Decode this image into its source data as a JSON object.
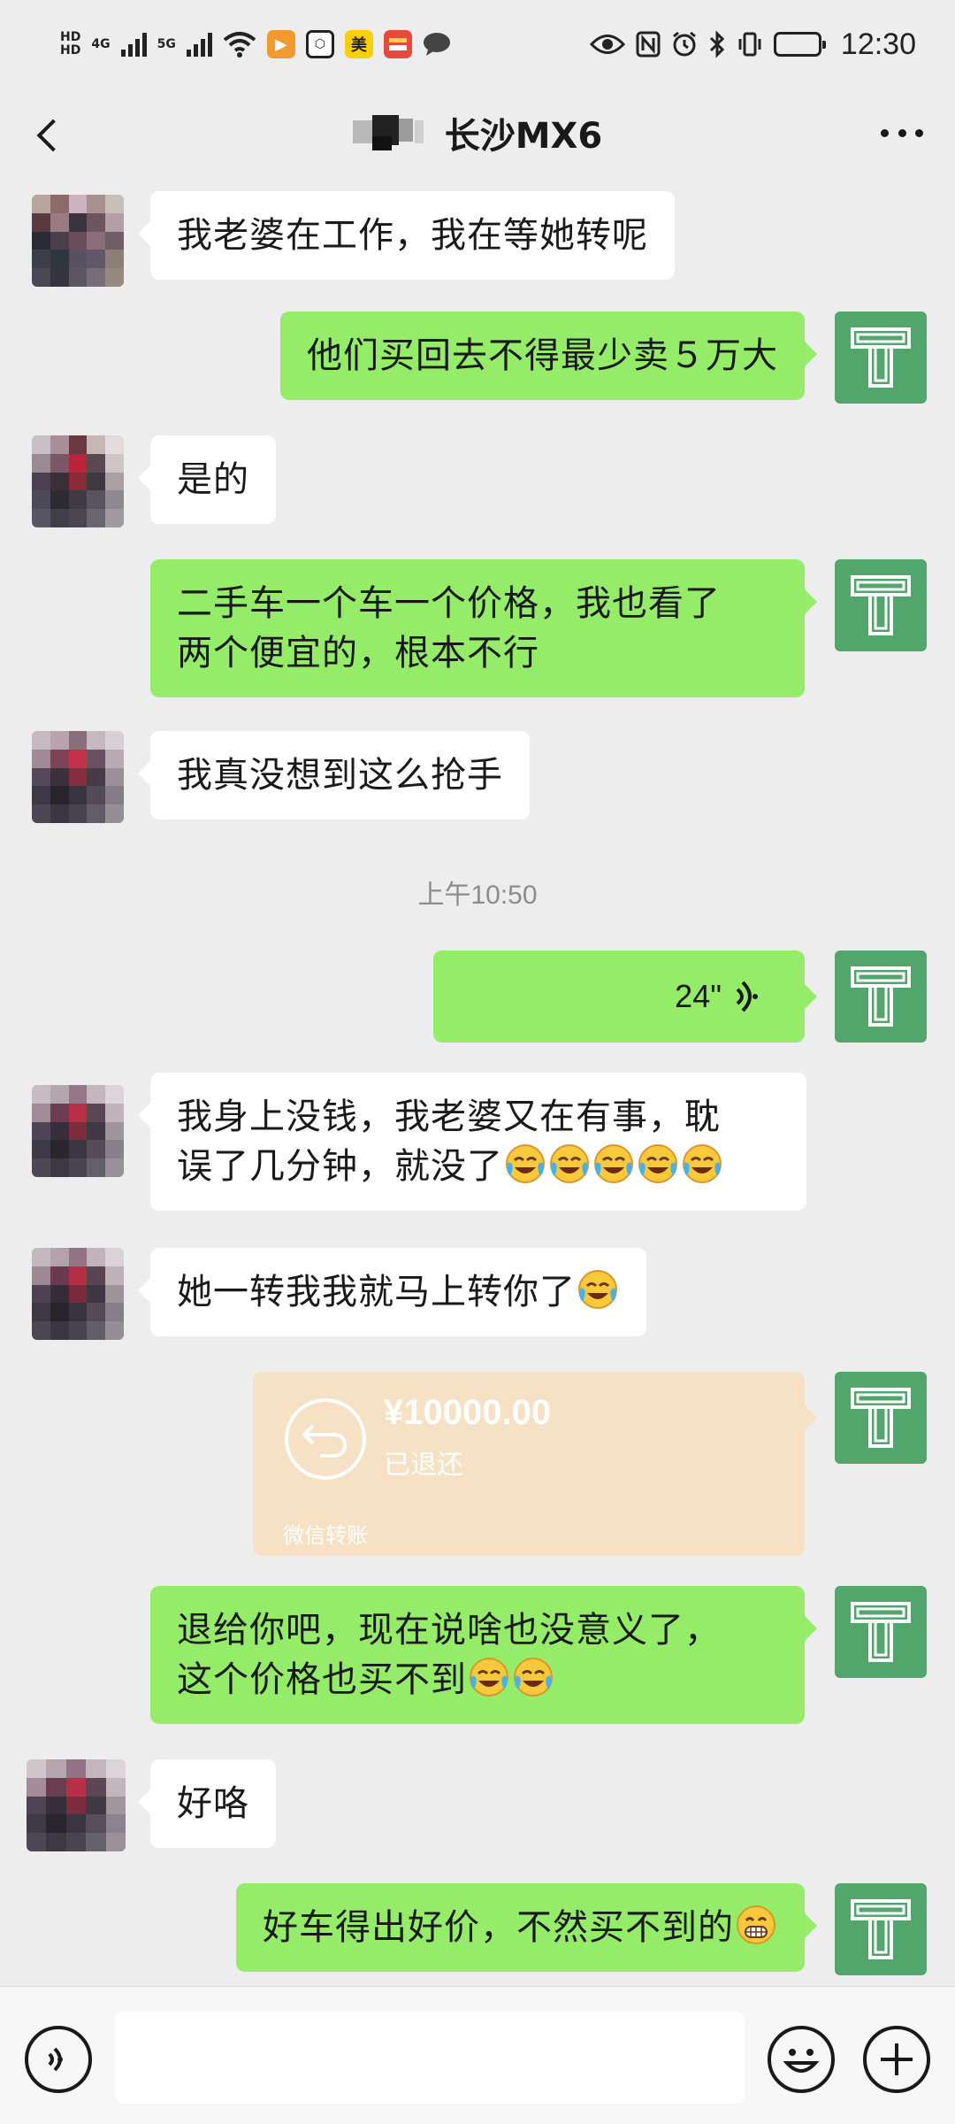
{
  "status_bar": {
    "net1": "HD",
    "net2": "4G",
    "net3": "5G",
    "app_meituan": "美",
    "time": "12:30",
    "icons": [
      "hd-icon",
      "signal-icon",
      "wifi-icon",
      "play-icon",
      "shield-icon",
      "meituan-icon",
      "app-icon",
      "chat-icon",
      "eye-icon",
      "nfc-icon",
      "alarm-icon",
      "bluetooth-icon",
      "vibrate-icon",
      "battery-icon"
    ]
  },
  "header": {
    "title": "长沙MX6",
    "back_icon": "chevron-left-icon",
    "more_icon": "more-icon"
  },
  "messages": [
    {
      "side": "left",
      "text": "我老婆在工作，我在等她转呢"
    },
    {
      "side": "right",
      "text": "他们买回去不得最少卖５万大"
    },
    {
      "side": "left",
      "text": "是的"
    },
    {
      "side": "right",
      "line1": "二手车一个车一个价格，我也看了",
      "line2": "两个便宜的，根本不行"
    },
    {
      "side": "left",
      "text": "我真没想到这么抢手"
    },
    {
      "type": "timestamp",
      "text": "上午10:50"
    },
    {
      "side": "right",
      "type": "voice",
      "duration": "24\""
    },
    {
      "side": "left",
      "line1": "我身上没钱，我老婆又在有事，耽",
      "line2": "误了几分钟，就没了"
    },
    {
      "side": "left",
      "text": "她一转我我就马上转你了"
    },
    {
      "side": "right",
      "type": "transfer",
      "amount": "¥10000.00",
      "status": "已退还",
      "footer": "微信转账"
    },
    {
      "side": "right",
      "line1": "退给你吧，现在说啥也没意义了，",
      "line2": "这个价格也买不到"
    },
    {
      "side": "left",
      "text": "好咯"
    },
    {
      "side": "right",
      "text": "好车得出好价，不然买不到的"
    }
  ],
  "input_bar": {
    "voice_icon": "voice-icon",
    "emoji_icon": "emoji-icon",
    "plus_icon": "plus-icon"
  },
  "colors": {
    "background": "#ededed",
    "bubble_right": "#95ec69",
    "bubble_left": "#ffffff",
    "avatar_right": "#52a56b",
    "transfer": "#f6e1c4"
  }
}
